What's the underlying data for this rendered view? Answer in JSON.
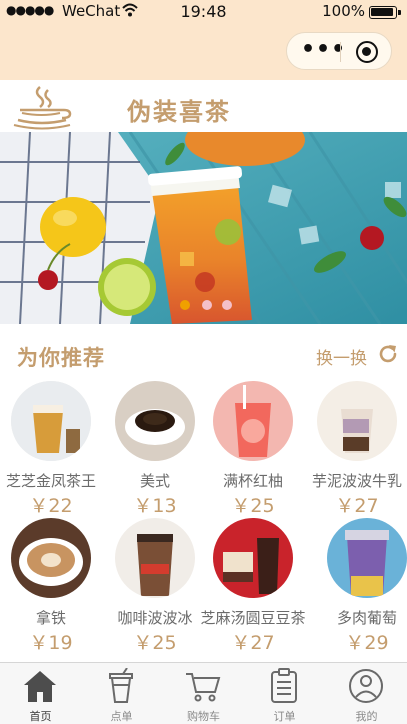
{
  "status_bar": {
    "signal": "●●●●●",
    "carrier": "WeChat",
    "time": "19:48",
    "battery": "100%"
  },
  "header": {
    "brand": "伪装喜茶"
  },
  "banner": {
    "active_index": 0,
    "slide_count": 3
  },
  "recommend": {
    "title": "为你推荐",
    "refresh_label": "换一换"
  },
  "products": [
    {
      "name": "芝芝金凤茶王",
      "price": "￥22"
    },
    {
      "name": "美式",
      "price": "￥13"
    },
    {
      "name": "满杯红柚",
      "price": "￥25"
    },
    {
      "name": "芋泥波波牛乳",
      "price": "￥27"
    },
    {
      "name": "拿铁",
      "price": "￥19"
    },
    {
      "name": "咖啡波波冰",
      "price": "￥25"
    },
    {
      "name": "芝麻汤圆豆豆茶",
      "price": "￥27"
    },
    {
      "name": "多肉葡萄",
      "price": "￥29"
    }
  ],
  "tabbar": {
    "items": [
      {
        "label": "首页",
        "icon": "home-icon"
      },
      {
        "label": "点单",
        "icon": "cup-icon"
      },
      {
        "label": "购物车",
        "icon": "cart-icon"
      },
      {
        "label": "订单",
        "icon": "order-icon"
      },
      {
        "label": "我的",
        "icon": "profile-icon"
      }
    ],
    "active": 0
  },
  "colors": {
    "accent": "#c49d6e",
    "nav_bg": "#fce6cc",
    "indicator_active": "#f0a000",
    "indicator_inactive": "#f4c0c8"
  }
}
